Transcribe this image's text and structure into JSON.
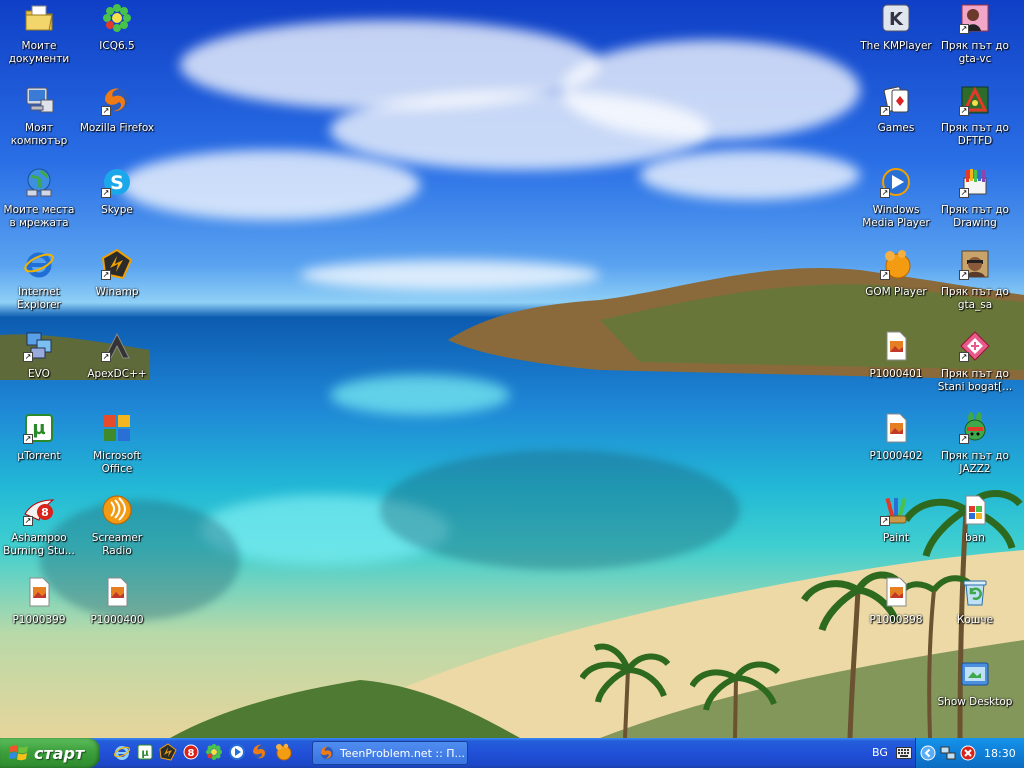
{
  "desktop": {
    "icons": [
      {
        "label": "Моите документи",
        "icon": "my-documents-icon"
      },
      {
        "label": "ICQ6.5",
        "icon": "icq-icon"
      },
      {
        "label": "Моят компютър",
        "icon": "my-computer-icon"
      },
      {
        "label": "Mozilla Firefox",
        "icon": "firefox-icon"
      },
      {
        "label": "Моите места в мрежата",
        "icon": "network-places-icon"
      },
      {
        "label": "Skype",
        "icon": "skype-icon"
      },
      {
        "label": "Internet Explorer",
        "icon": "internet-explorer-icon"
      },
      {
        "label": "Winamp",
        "icon": "winamp-icon"
      },
      {
        "label": "EVO",
        "icon": "evo-icon"
      },
      {
        "label": "ApexDC++",
        "icon": "apexdc-icon"
      },
      {
        "label": "µTorrent",
        "icon": "utorrent-icon"
      },
      {
        "label": "Microsoft Office",
        "icon": "microsoft-office-icon"
      },
      {
        "label": "Ashampoo Burning Stu...",
        "icon": "ashampoo-icon"
      },
      {
        "label": "Screamer Radio",
        "icon": "screamer-radio-icon"
      },
      {
        "label": "P1000399",
        "icon": "image-file-icon"
      },
      {
        "label": "P1000400",
        "icon": "image-file-icon"
      },
      {
        "label": "The KMPlayer",
        "icon": "kmplayer-icon"
      },
      {
        "label": "Пряк път до gta-vc",
        "icon": "gta-vc-icon"
      },
      {
        "label": "Games",
        "icon": "games-icon"
      },
      {
        "label": "Пряк път до DFTFD",
        "icon": "dftfd-icon"
      },
      {
        "label": "Windows Media Player",
        "icon": "windows-media-player-icon"
      },
      {
        "label": "Пряк път до Drawing",
        "icon": "drawing-icon"
      },
      {
        "label": "GOM Player",
        "icon": "gom-player-icon"
      },
      {
        "label": "Пряк път до gta_sa",
        "icon": "gta-sa-icon"
      },
      {
        "label": "P1000401",
        "icon": "image-file-icon"
      },
      {
        "label": "Пряк път до Stani bogat[...",
        "icon": "stani-bogat-icon"
      },
      {
        "label": "P1000402",
        "icon": "image-file-icon"
      },
      {
        "label": "Пряк път до JAZZ2",
        "icon": "jazz2-icon"
      },
      {
        "label": "Paint",
        "icon": "paint-icon"
      },
      {
        "label": "ban",
        "icon": "ban-file-icon"
      },
      {
        "label": "P1000398",
        "icon": "image-file-icon"
      },
      {
        "label": "Кошче",
        "icon": "recycle-bin-icon"
      },
      {
        "label": "Show Desktop",
        "icon": "show-desktop-icon"
      }
    ]
  },
  "taskbar": {
    "start_label": "старт",
    "quick_launch": [
      "internet-explorer-icon",
      "utorrent-icon",
      "winamp-icon",
      "ashampoo-icon",
      "icq-icon",
      "windows-media-player-icon",
      "firefox-icon",
      "gom-player-icon"
    ],
    "active_window": "TeenProblem.net :: П...",
    "language": "BG",
    "clock": "18:30"
  },
  "colors": {
    "taskbar": "#245edb",
    "start_button": "#3c9f3c",
    "tray": "#0f7fd8"
  }
}
